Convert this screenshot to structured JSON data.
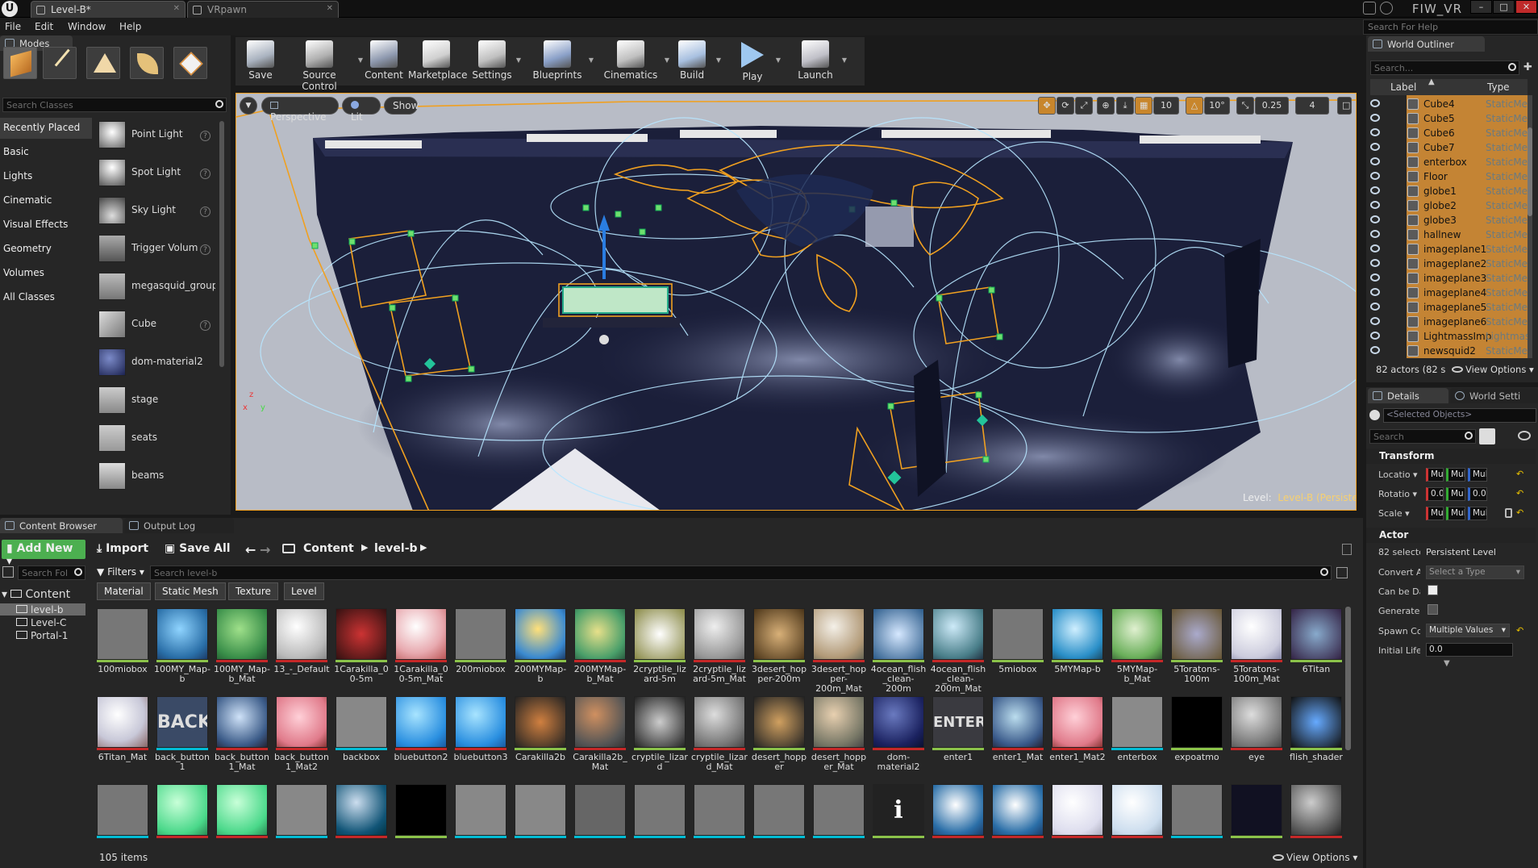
{
  "window": {
    "tabs": [
      {
        "label": "Level-B*"
      },
      {
        "label": "VRpawn"
      }
    ],
    "project": "FIW_VR",
    "search_help_placeholder": "Search For Help",
    "buttons": {
      "min": "–",
      "max": "□",
      "close": "✕"
    }
  },
  "menu": [
    "File",
    "Edit",
    "Window",
    "Help"
  ],
  "modes": {
    "title": "Modes",
    "search_placeholder": "Search Classes",
    "categories": [
      "Recently Placed",
      "Basic",
      "Lights",
      "Cinematic",
      "Visual Effects",
      "Geometry",
      "Volumes",
      "All Classes"
    ],
    "items": [
      "Point Light",
      "Spot Light",
      "Sky Light",
      "Trigger Volum",
      "megasquid_group",
      "Cube",
      "dom-material2",
      "stage",
      "seats",
      "beams"
    ]
  },
  "toolbar": [
    "Save",
    "Source Control",
    "Content",
    "Marketplace",
    "Settings",
    "Blueprints",
    "Cinematics",
    "Build",
    "Play",
    "Launch"
  ],
  "viewport": {
    "perspective": "Perspective",
    "lit": "Lit",
    "show": "Show",
    "grid": "10",
    "angle": "10°",
    "scale": "0.25",
    "speed": "4",
    "level_label": "Level:",
    "level_name": "Level-B (Persistent)",
    "axes": {
      "x": "x",
      "y": "y",
      "z": "z"
    }
  },
  "outliner": {
    "title": "World Outliner",
    "search_placeholder": "Search...",
    "col_label": "Label",
    "col_type": "Type",
    "rows": [
      {
        "name": "Cube4",
        "type": "StaticMes"
      },
      {
        "name": "Cube5",
        "type": "StaticMes"
      },
      {
        "name": "Cube6",
        "type": "StaticMes"
      },
      {
        "name": "Cube7",
        "type": "StaticMes"
      },
      {
        "name": "enterbox",
        "type": "StaticMes"
      },
      {
        "name": "Floor",
        "type": "StaticMes"
      },
      {
        "name": "globe1",
        "type": "StaticMes"
      },
      {
        "name": "globe2",
        "type": "StaticMes"
      },
      {
        "name": "globe3",
        "type": "StaticMes"
      },
      {
        "name": "hallnew",
        "type": "StaticMes"
      },
      {
        "name": "imageplane1",
        "type": "StaticMes"
      },
      {
        "name": "imageplane2",
        "type": "StaticMes"
      },
      {
        "name": "imageplane3",
        "type": "StaticMes"
      },
      {
        "name": "imageplane4",
        "type": "StaticMes"
      },
      {
        "name": "imageplane5",
        "type": "StaticMes"
      },
      {
        "name": "imageplane6",
        "type": "StaticMes"
      },
      {
        "name": "LightmassImp",
        "type": "Lightmas"
      },
      {
        "name": "newsquid2",
        "type": "StaticMes"
      }
    ],
    "actor_count": "82 actors (82 s",
    "view_options": "View Options"
  },
  "details": {
    "tab": "Details",
    "tab2": "World Setti",
    "selected_placeholder": "<Selected Objects>",
    "search_placeholder": "Search",
    "transform": "Transform",
    "location": "Locatio",
    "rotation": "Rotatio",
    "scale": "Scale",
    "mult": "Mult",
    "mu": "Mu",
    "zero": "0.0",
    "actor": "Actor",
    "selected": "82 selecte",
    "persistent": "Persistent Level",
    "convert": "Convert Ac",
    "select_type": "Select a Type",
    "can_be_damaged": "Can be Dar",
    "generate": "Generate C",
    "spawn": "Spawn Col",
    "spawn_value": "Multiple Values",
    "initial_life": "Initial Life",
    "initial_value": "0.0"
  },
  "bottom_tabs": {
    "content_browser": "Content Browser",
    "output_log": "Output Log"
  },
  "content": {
    "add_new": "Add New",
    "import": "Import",
    "save_all": "Save All",
    "path": [
      "Content",
      "level-b"
    ],
    "folder_search": "Search Fol",
    "filters": "Filters",
    "search_placeholder": "Search level-b",
    "chips": [
      "Material",
      "Static Mesh",
      "Texture",
      "Level"
    ],
    "tree": [
      "Content",
      "level-b",
      "Level-C",
      "Portal-1"
    ],
    "item_count": "105 items",
    "view_options": "View Options",
    "row1": [
      "100miobox",
      "100MY_Map-b",
      "100MY_Map-b_Mat",
      "13_-_Default",
      "1Carakilla_00-5m",
      "1Carakilla_00-5m_Mat",
      "200miobox",
      "200MYMap-b",
      "200MYMap-b_Mat",
      "2cryptile_lizard-5m",
      "2cryptile_lizard-5m_Mat",
      "3desert_hopper-200m",
      "3desert_hopper-200m_Mat",
      "4ocean_flish_clean-200m",
      "4ocean_flish_clean-200m_Mat",
      "5miobox",
      "5MYMap-b",
      "5MYMap-b_Mat",
      "5Toratons-100m",
      "5Toratons-100m_Mat",
      "6Titan"
    ],
    "row2": [
      "6Titan_Mat",
      "back_button1",
      "back_button1_Mat",
      "back_button1_Mat2",
      "backbox",
      "bluebutton2",
      "bluebutton3",
      "Carakilla2b",
      "Carakilla2b_Mat",
      "cryptile_lizard",
      "cryptile_lizard_Mat",
      "desert_hopper",
      "desert_hopper_Mat",
      "dom-material2",
      "enter1",
      "enter1_Mat",
      "enter1_Mat2",
      "enterbox",
      "expoatmo",
      "eye",
      "flish_shader"
    ],
    "thumb_text": {
      "back": "BACK",
      "enter": "ENTER",
      "info": "i"
    }
  },
  "colors": {
    "accent": "#f0a020",
    "material_bar": "#8bc34a",
    "mesh_bar": "#00bcd4",
    "texture_bar": "#c62828",
    "add_new": "#4caf50"
  }
}
